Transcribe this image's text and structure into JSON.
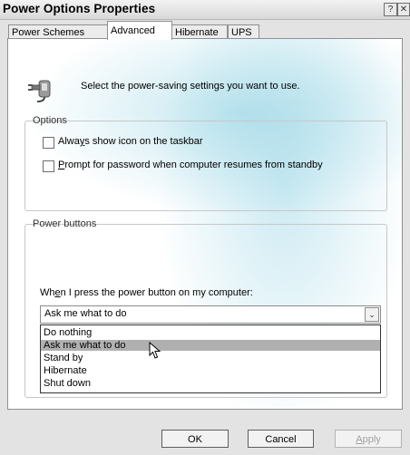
{
  "window": {
    "title": "Power Options Properties",
    "help_glyph": "?",
    "close_glyph": "✕"
  },
  "tabs": [
    {
      "label": "Power Schemes"
    },
    {
      "label": "Advanced"
    },
    {
      "label": "Hibernate"
    },
    {
      "label": "UPS"
    }
  ],
  "intro": {
    "text": "Select the power-saving settings you want to use."
  },
  "options": {
    "group_label": "Options",
    "show_icon": {
      "pre": "Alwa",
      "u": "y",
      "post": "s show icon on the taskbar",
      "checked": false
    },
    "prompt_password": {
      "pre": "",
      "u": "P",
      "post": "rompt for password when computer resumes from standby",
      "checked": false
    }
  },
  "power_buttons": {
    "group_label": "Power buttons",
    "prompt": {
      "pre": "Wh",
      "u": "e",
      "post": "n I press the power button on my computer:"
    },
    "selected": "Ask me what to do",
    "dropdown_glyph": "⌄",
    "options": [
      "Do nothing",
      "Ask me what to do",
      "Stand by",
      "Hibernate",
      "Shut down"
    ],
    "highlighted_index": 1
  },
  "buttons": {
    "ok": "OK",
    "cancel": "Cancel",
    "apply_pre": "",
    "apply_u": "A",
    "apply_post": "pply"
  }
}
